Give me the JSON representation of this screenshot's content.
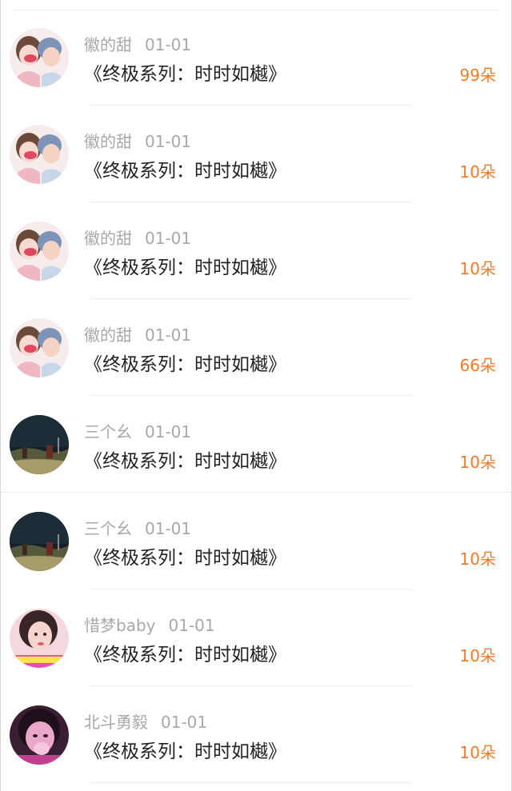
{
  "items": [
    {
      "user": "徽的甜",
      "date": "01-01",
      "title": "《终极系列：时时如樾》",
      "count": "99朵",
      "avatar": "cartoon-couple"
    },
    {
      "user": "徽的甜",
      "date": "01-01",
      "title": "《终极系列：时时如樾》",
      "count": "10朵",
      "avatar": "cartoon-couple"
    },
    {
      "user": "徽的甜",
      "date": "01-01",
      "title": "《终极系列：时时如樾》",
      "count": "10朵",
      "avatar": "cartoon-couple"
    },
    {
      "user": "徽的甜",
      "date": "01-01",
      "title": "《终极系列：时时如樾》",
      "count": "66朵",
      "avatar": "cartoon-couple"
    },
    {
      "user": "三个幺",
      "date": "01-01",
      "title": "《终极系列：时时如樾》",
      "count": "10朵",
      "avatar": "dark-landscape"
    },
    {
      "user": "三个幺",
      "date": "01-01",
      "title": "《终极系列：时时如樾》",
      "count": "10朵",
      "avatar": "dark-landscape"
    },
    {
      "user": "惜梦baby",
      "date": "01-01",
      "title": "《终极系列：时时如樾》",
      "count": "10朵",
      "avatar": "girl-portrait"
    },
    {
      "user": "北斗勇毅",
      "date": "01-01",
      "title": "《终极系列：时时如樾》",
      "count": "10朵",
      "avatar": "girl-pink-portrait"
    }
  ],
  "colors": {
    "count": "#f07c2a",
    "title": "#222222",
    "meta": "#a8a8a8"
  }
}
